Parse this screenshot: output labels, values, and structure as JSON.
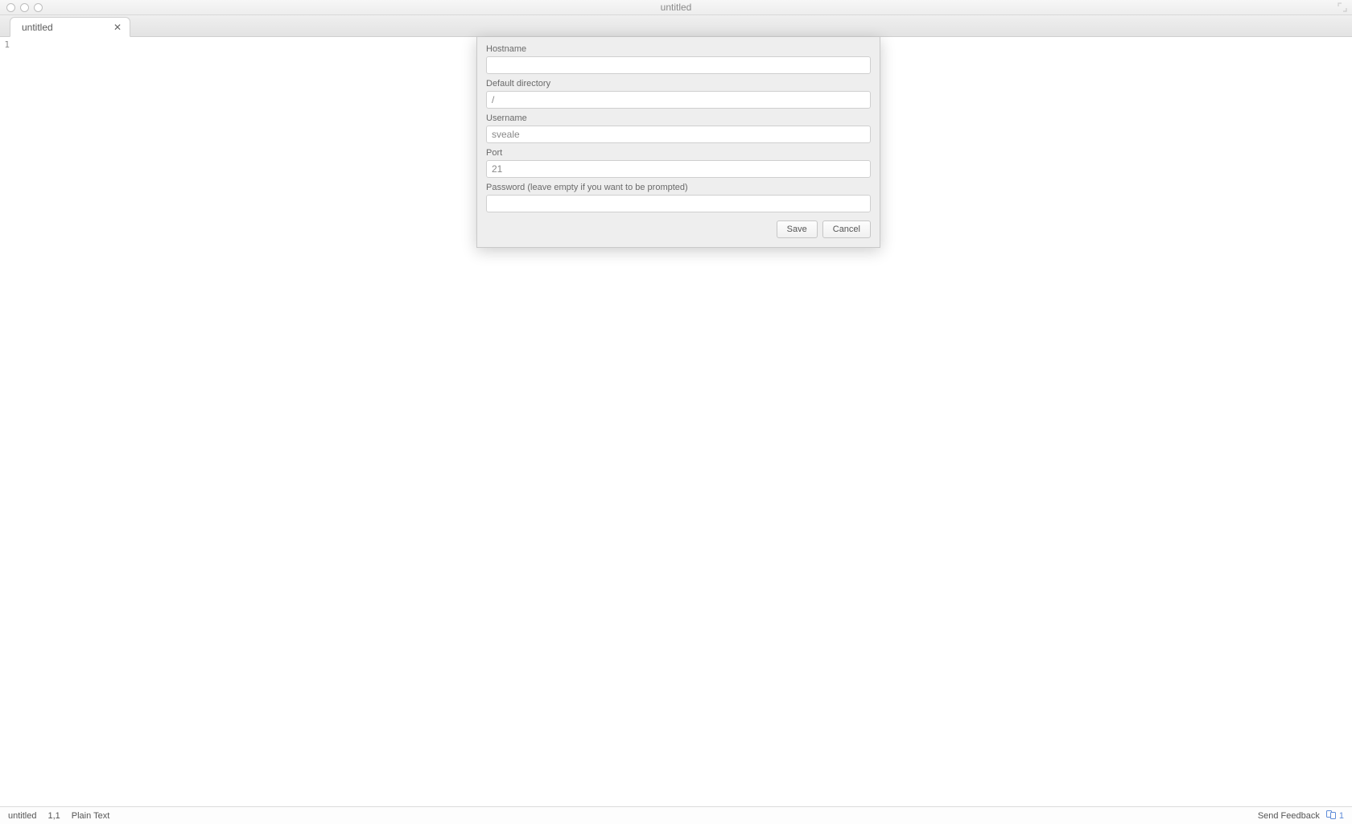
{
  "window": {
    "title": "untitled"
  },
  "tab": {
    "name": "untitled"
  },
  "gutter": {
    "line1": "1"
  },
  "dialog": {
    "hostname": {
      "label": "Hostname",
      "value": ""
    },
    "directory": {
      "label": "Default directory",
      "value": "/"
    },
    "username": {
      "label": "Username",
      "value": "sveale"
    },
    "port": {
      "label": "Port",
      "value": "21"
    },
    "password": {
      "label": "Password (leave empty if you want to be prompted)",
      "value": ""
    },
    "save": "Save",
    "cancel": "Cancel"
  },
  "status": {
    "filename": "untitled",
    "position": "1,1",
    "syntax": "Plain Text",
    "feedback": "Send Feedback",
    "notif_count": "1"
  }
}
